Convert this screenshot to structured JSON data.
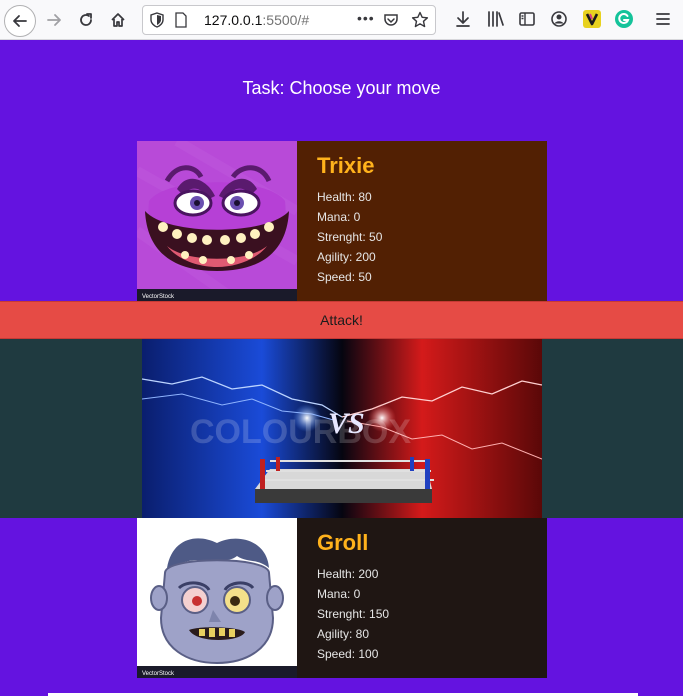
{
  "browser": {
    "url_host": "127.0.0.1",
    "url_rest": ":5500/#",
    "more_glyph": "•••"
  },
  "page": {
    "title": "Task: Choose your move",
    "attack_label": "Attack!"
  },
  "fighters": [
    {
      "name": "Trixie",
      "stats": [
        "Health: 80",
        "Mana: 0",
        "Strenght: 50",
        "Agility: 200",
        "Speed: 50"
      ],
      "watermark": "VectorStock"
    },
    {
      "name": "Groll",
      "stats": [
        "Health: 200",
        "Mana: 0",
        "Strenght: 150",
        "Agility: 80",
        "Speed: 100"
      ],
      "watermark": "VectorStock"
    }
  ],
  "arena": {
    "vs_text": "VS",
    "watermark": "COLOURBOX"
  },
  "colors": {
    "page_bg": "#6413e0",
    "trixie_card_bg": "#522003",
    "groll_card_bg": "#1f1613",
    "attack_bar": "#e64b45",
    "arena_band": "#1f3a40",
    "name_color": "#ffb21c"
  },
  "icons": [
    "back-icon",
    "forward-icon",
    "reload-icon",
    "home-icon",
    "shield-icon",
    "page-icon",
    "pocket-icon",
    "star-icon",
    "download-icon",
    "library-icon",
    "sidebar-icon",
    "account-icon",
    "extension-v-icon",
    "grammarly-icon",
    "hamburger-menu-icon"
  ]
}
